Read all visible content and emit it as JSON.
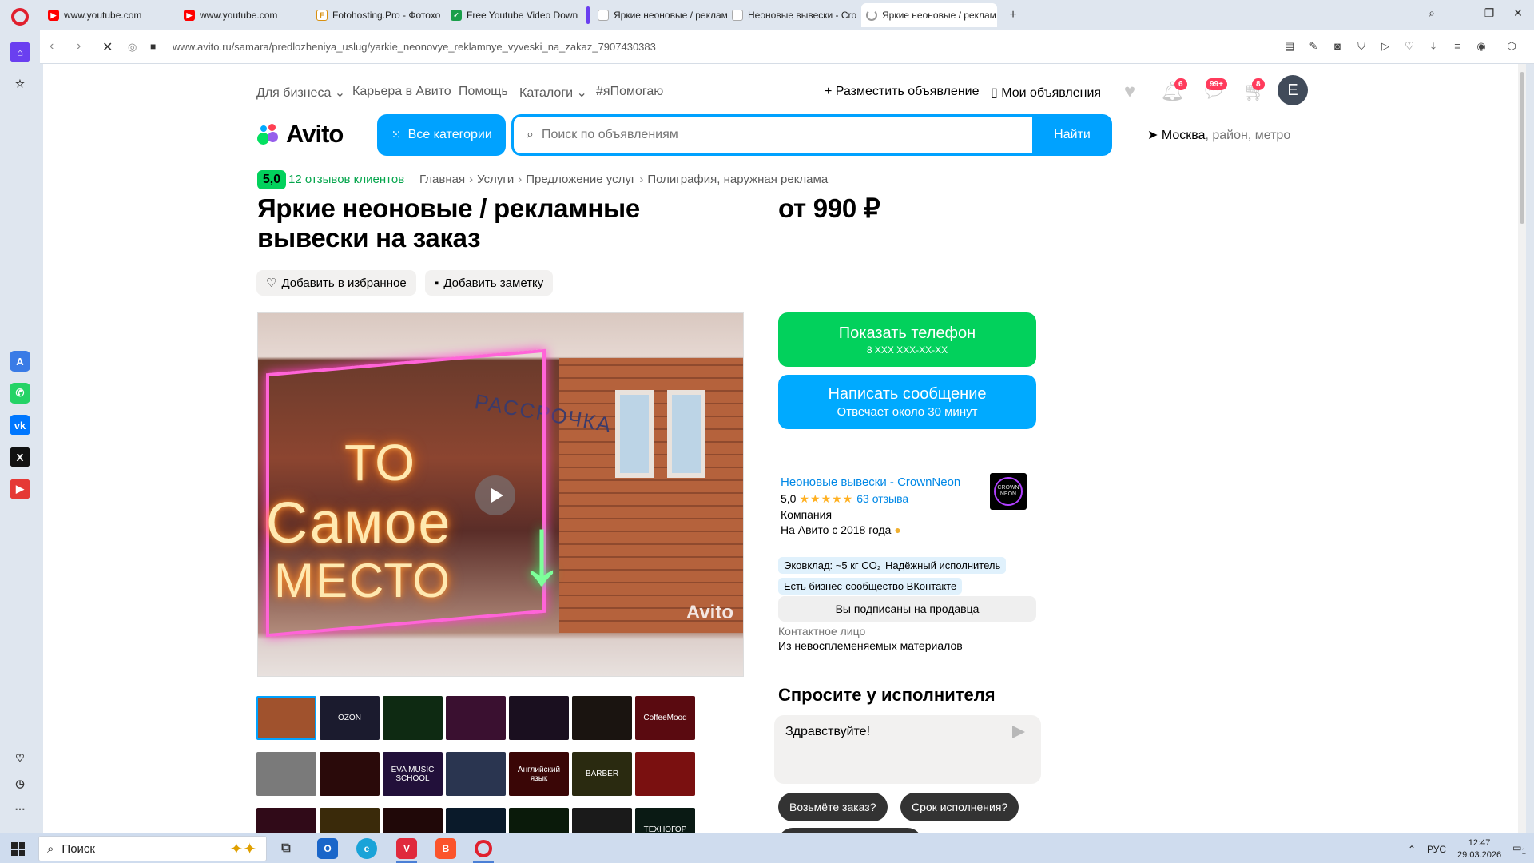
{
  "browser": {
    "tabs": [
      {
        "title": "www.youtube.com",
        "favicon": "youtube-icon"
      },
      {
        "title": "www.youtube.com",
        "favicon": "youtube-icon"
      },
      {
        "title": "Fotohosting.Pro - Фотохо",
        "favicon": "fotohosting-icon"
      },
      {
        "title": "Free Youtube Video Down",
        "favicon": "downloader-icon"
      },
      {
        "title": "Яркие неоновые / реклам",
        "favicon": "avito-icon"
      },
      {
        "title": "Неоновые вывески - Cro",
        "favicon": "avito-icon"
      },
      {
        "title": "Яркие неоновые / реклам",
        "favicon": "loading-icon",
        "active": true
      }
    ],
    "url": "www.avito.ru/samara/predlozheniya_uslug/yarkie_neonovye_reklamnye_vyveski_na_zakaz_7907430383",
    "accent": "#6a3ff0"
  },
  "header": {
    "nav": [
      "Для бизнеса",
      "Карьера в Авито",
      "Помощь",
      "Каталоги",
      "#яПомогаю"
    ],
    "post_ad": "Разместить объявление",
    "my_ads": "Мои объявления",
    "notifications_count": "6",
    "messages_count": "99+",
    "cart_count": "8",
    "avatar_letter": "E"
  },
  "search": {
    "logo": "Avito",
    "all_categories": "Все категории",
    "placeholder": "Поиск по объявлениям",
    "button": "Найти",
    "location_city": "Москва",
    "location_rest": ", район, метро"
  },
  "listing": {
    "rating_badge": "5,0",
    "reviews_link": "12 отзывов клиентов",
    "breadcrumbs": [
      "Главная",
      "Услуги",
      "Предложение услуг",
      "Полиграфия, наружная реклама"
    ],
    "title": "Яркие неоновые / рекламные вывески на заказ",
    "price": "от 990 ₽",
    "add_favorite": "Добавить в избранное",
    "add_note": "Добавить заметку",
    "watermark": "Avito",
    "neon_lines": [
      "ТО",
      "Самое",
      "МЕСТО"
    ],
    "sign_text": "РАССРОЧКА",
    "thumbnails": [
      {
        "label": "",
        "bg": "#a0522d"
      },
      {
        "label": "OZON",
        "bg": "#1b1b2e"
      },
      {
        "label": "",
        "bg": "#0e2a12"
      },
      {
        "label": "",
        "bg": "#3a1030"
      },
      {
        "label": "",
        "bg": "#1a0f1f"
      },
      {
        "label": "",
        "bg": "#1a1410"
      },
      {
        "label": "CoffeeMood",
        "bg": "#5a0a10"
      },
      {
        "label": "",
        "bg": "#7a7a7a"
      },
      {
        "label": "",
        "bg": "#2a0a0a"
      },
      {
        "label": "EVA MUSIC SCHOOL",
        "bg": "#22103a"
      },
      {
        "label": "",
        "bg": "#2a3550"
      },
      {
        "label": "Английский язык",
        "bg": "#3a0606"
      },
      {
        "label": "BARBER",
        "bg": "#2a2a10"
      },
      {
        "label": "",
        "bg": "#7a1010"
      },
      {
        "label": "",
        "bg": "#300a18"
      },
      {
        "label": "",
        "bg": "#3a2a0a"
      },
      {
        "label": "",
        "bg": "#200808"
      },
      {
        "label": "",
        "bg": "#0a1a2a"
      },
      {
        "label": "",
        "bg": "#0a1a0a"
      },
      {
        "label": "",
        "bg": "#1a1a1a"
      },
      {
        "label": "ТЕХНОГОР",
        "bg": "#0a1a14"
      }
    ]
  },
  "contact": {
    "phone_title": "Показать телефон",
    "phone_masked": "8 XXX XXX-XX-XX",
    "message_title": "Написать сообщение",
    "message_sub": "Отвечает около 30 минут"
  },
  "seller": {
    "name": "Неоновые вывески - CrownNeon",
    "rating": "5,0",
    "stars": "★★★★★",
    "reviews": "63 отзыва",
    "type": "Компания",
    "since": "На Авито с 2018 года",
    "logo_text": "CROWN NEON",
    "tags": [
      "Эковклад: ~5 кг CO₂",
      "Надёжный исполнитель",
      "Есть бизнес-сообщество ВКонтакте"
    ],
    "subscribed": "Вы подписаны на продавца",
    "contact_label": "Контактное лицо",
    "contact_value": "Из невосплеменяемых материалов"
  },
  "ask": {
    "title": "Спросите у исполнителя",
    "message": "Здравствуйте!",
    "chips": [
      "Возьмёте заказ?",
      "Срок исполнения?"
    ]
  },
  "taskbar": {
    "search": "Поиск",
    "lang": "РУС",
    "time": "12:47",
    "date": "29.03.2026",
    "notifications": "1"
  }
}
